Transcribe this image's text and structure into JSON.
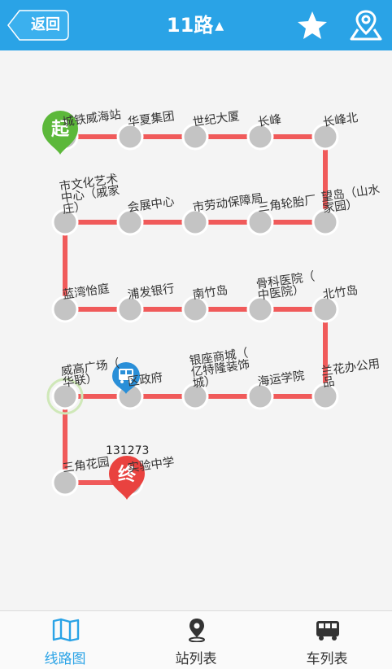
{
  "header": {
    "back_label": "返回",
    "title": "11路",
    "title_caret": "▲",
    "star_icon": "star-icon",
    "map_icon": "map-pin-icon"
  },
  "route": {
    "stations": [
      "城铁威海站",
      "华夏集团",
      "世纪大厦",
      "长峰",
      "长峰北",
      "望岛（山水家园）",
      "三角轮胎厂",
      "市劳动保障局",
      "会展中心",
      "市文化艺术中心（戚家庄）",
      "蓝湾怡庭",
      "浦发银行",
      "南竹岛",
      "骨科医院（中医院）",
      "北竹岛",
      "兰花办公用品",
      "海运学院",
      "银座商城（亿特隆装饰城）",
      "区政府",
      "威高广场（华联）",
      "三角花园",
      "实验中学"
    ],
    "start_badge": "起",
    "end_badge": "终",
    "bus_number": "131273",
    "bus_icon": "bus-icon",
    "line_color": "#f05a5a",
    "station_color": "#c4c4c4",
    "start_color": "#5cb83a",
    "end_color": "#e9423f",
    "bus_badge_color": "#2a8fd8"
  },
  "tabs": [
    {
      "label": "线路图",
      "icon": "map-book-icon",
      "active": true
    },
    {
      "label": "站列表",
      "icon": "location-pin-icon",
      "active": false
    },
    {
      "label": "车列表",
      "icon": "bus-icon",
      "active": false
    }
  ],
  "colors": {
    "primary": "#2aa3e6"
  }
}
